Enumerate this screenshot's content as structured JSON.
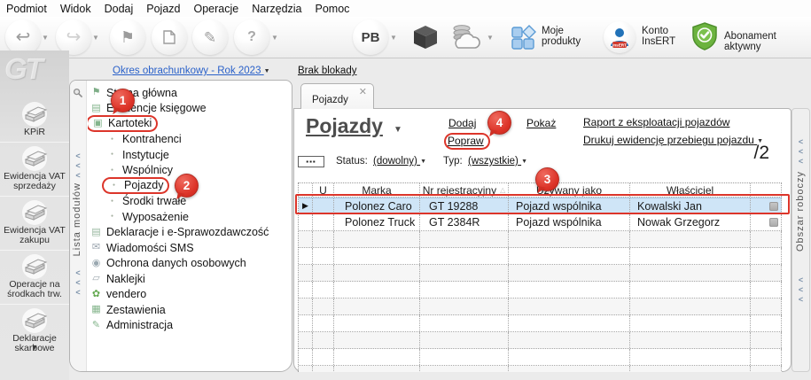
{
  "menu_bar": {
    "items": [
      "Podmiot",
      "Widok",
      "Dodaj",
      "Pojazd",
      "Operacje",
      "Narzędzia",
      "Pomoc"
    ]
  },
  "toolbar": {
    "pb_label": "PB",
    "moje_produkty_line1": "Moje",
    "moje_produkty_line2": "produkty",
    "konto_line1": "Konto",
    "konto_line2": "InsERT",
    "konto_badge": "InsERT",
    "abonament_label": "Abonament aktywny",
    "icons": [
      "undo-arrow-icon",
      "redo-arrow-icon",
      "flag-icon",
      "new-document-icon",
      "pen-icon",
      "help-bubble-icon",
      "cube-icon",
      "cloud-archive-icon",
      "products-grid-icon",
      "user-icon",
      "shield-check-icon"
    ]
  },
  "module_sidebar": {
    "logo": "GT",
    "vertical_label": "Lista modułów",
    "items": [
      {
        "label": "KPiR",
        "icon": "ledger-icon"
      },
      {
        "label": "Ewidencja VAT sprzedaży",
        "icon": "ledger-icon"
      },
      {
        "label": "Ewidencja VAT zakupu",
        "icon": "ledger-icon"
      },
      {
        "label": "Operacje na środkach trw.",
        "icon": "ledger-icon"
      },
      {
        "label": "Deklaracje skarbowe",
        "icon": "ledger-icon"
      }
    ],
    "more_glyph": "▼"
  },
  "period_bar": {
    "okres_link": "Okres obrachunkowy - Rok 2023",
    "blokada_link": "Brak blokady"
  },
  "nav_tree": {
    "items": [
      {
        "label": "Strona główna",
        "icon": "flag-icon",
        "level": 0,
        "annotated": false
      },
      {
        "label": "Ewidencje księgowe",
        "icon": "ledger-icon",
        "level": 0,
        "annotated": false
      },
      {
        "label": "Kartoteki",
        "icon": "cards-icon",
        "level": 0,
        "annotated": true
      },
      {
        "label": "Kontrahenci",
        "icon": "bullet",
        "level": 1,
        "annotated": false
      },
      {
        "label": "Instytucje",
        "icon": "bullet",
        "level": 1,
        "annotated": false
      },
      {
        "label": "Wspólnicy",
        "icon": "bullet",
        "level": 1,
        "annotated": false
      },
      {
        "label": "Pojazdy",
        "icon": "bullet",
        "level": 1,
        "annotated": true
      },
      {
        "label": "Środki trwałe",
        "icon": "bullet",
        "level": 1,
        "annotated": false
      },
      {
        "label": "Wyposażenie",
        "icon": "bullet",
        "level": 1,
        "annotated": false
      },
      {
        "label": "Deklaracje i e-Sprawozdawczość",
        "icon": "docs-icon",
        "level": 0,
        "annotated": false
      },
      {
        "label": "Wiadomości SMS",
        "icon": "sms-icon",
        "level": 0,
        "annotated": false
      },
      {
        "label": "Ochrona danych osobowych",
        "icon": "privacy-icon",
        "level": 0,
        "annotated": false
      },
      {
        "label": "Naklejki",
        "icon": "sticker-icon",
        "level": 0,
        "annotated": false
      },
      {
        "label": "vendero",
        "icon": "vendero-icon",
        "level": 0,
        "annotated": false
      },
      {
        "label": "Zestawienia",
        "icon": "reports-icon",
        "level": 0,
        "annotated": false
      },
      {
        "label": "Administracja",
        "icon": "admin-icon",
        "level": 0,
        "annotated": false
      }
    ]
  },
  "main": {
    "tab": {
      "label": "Pojazdy",
      "close_glyph": "✕"
    },
    "title": "Pojazdy",
    "actions": {
      "dodaj": "Dodaj",
      "popraw": "Popraw",
      "pokaz": "Pokaż",
      "raport": "Raport z eksploatacji pojazdów",
      "drukuj": "Drukuj ewidencję przebiegu pojazdu"
    },
    "filters": {
      "more_button": "▪▪▪",
      "status_label": "Status:",
      "status_value": "(dowolny)",
      "typ_label": "Typ:",
      "typ_value": "(wszystkie)"
    },
    "counter": "/2",
    "table": {
      "columns": [
        "U",
        "Marka",
        "Nr rejestracyjny",
        "Używany jako",
        "Właściciel"
      ],
      "sorted_column": "Nr rejestracyjny",
      "rows": [
        {
          "u": "",
          "marka": "Polonez Caro",
          "nr_rejestracyjny": "GT 19288",
          "uzywany_jako": "Pojazd wspólnika",
          "wlasciciel": "Kowalski Jan",
          "selected": true
        },
        {
          "u": "",
          "marka": "Polonez Truck",
          "nr_rejestracyjny": "GT 2384R",
          "uzywany_jako": "Pojazd wspólnika",
          "wlasciciel": "Nowak Grzegorz",
          "selected": false
        }
      ]
    }
  },
  "right_panel": {
    "vertical_label": "Obszar roboczy"
  },
  "annotations": {
    "badges": [
      "1",
      "2",
      "3",
      "4"
    ]
  },
  "colors": {
    "link_blue": "#2a61c9",
    "annotation_red": "#dc352a",
    "selection_blue": "#cfe5f7",
    "abonament_green": "#5aa432",
    "insert_blue": "#2272b8"
  }
}
